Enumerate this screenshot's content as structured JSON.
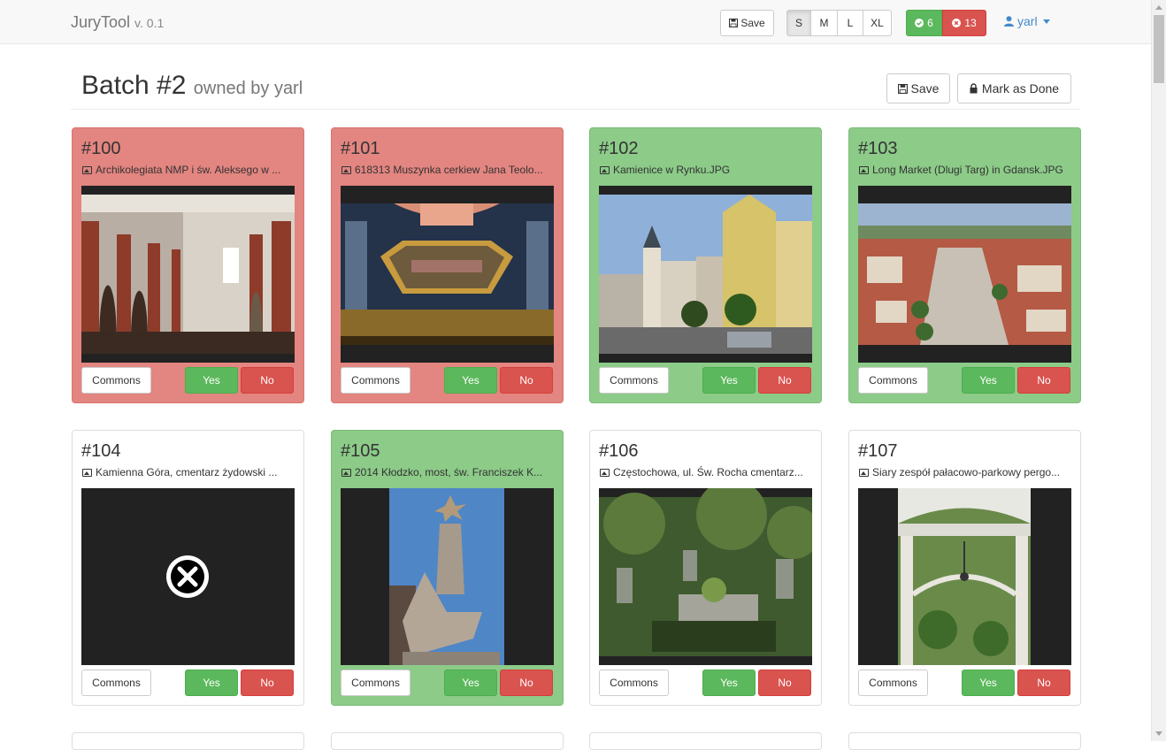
{
  "navbar": {
    "brand": "JuryTool",
    "version": "v. 0.1",
    "save_label": "Save",
    "sizes": [
      "S",
      "M",
      "L",
      "XL"
    ],
    "selected_size": "S",
    "yes_count": "6",
    "no_count": "13",
    "user": "yarl"
  },
  "header": {
    "title": "Batch #2",
    "owner": "owned by yarl",
    "save_label": "Save",
    "done_label": "Mark as Done"
  },
  "cards": [
    {
      "num": "#100",
      "file": "Archikolegiata NMP i św. Aleksego w ...",
      "status": "rejected",
      "photo": "church-interior"
    },
    {
      "num": "#101",
      "file": "618313 Muszynka cerkiew Jana Teolo...",
      "status": "rejected",
      "photo": "icon-painting"
    },
    {
      "num": "#102",
      "file": "Kamienice w Rynku.JPG",
      "status": "accepted",
      "photo": "town-square"
    },
    {
      "num": "#103",
      "file": "Long Market (Dlugi Targ) in Gdansk.JPG",
      "status": "accepted",
      "photo": "aerial-city"
    },
    {
      "num": "#104",
      "file": "Kamienna Góra, cmentarz żydowski ...",
      "status": "none",
      "photo": "missing"
    },
    {
      "num": "#105",
      "file": "2014 Kłodzko, most, św. Franciszek K...",
      "status": "accepted",
      "photo": "statue"
    },
    {
      "num": "#106",
      "file": "Częstochowa, ul. Św. Rocha cmentarz...",
      "status": "none",
      "photo": "cemetery"
    },
    {
      "num": "#107",
      "file": "Siary zespół pałacowo-parkowy pergo...",
      "status": "none",
      "photo": "pergola"
    }
  ],
  "card_buttons": {
    "commons": "Commons",
    "yes": "Yes",
    "no": "No"
  },
  "colors": {
    "accepted": "#8ccb88",
    "rejected": "#e38580",
    "yes": "#5cb85c",
    "no": "#d9534f",
    "link": "#428bca"
  }
}
